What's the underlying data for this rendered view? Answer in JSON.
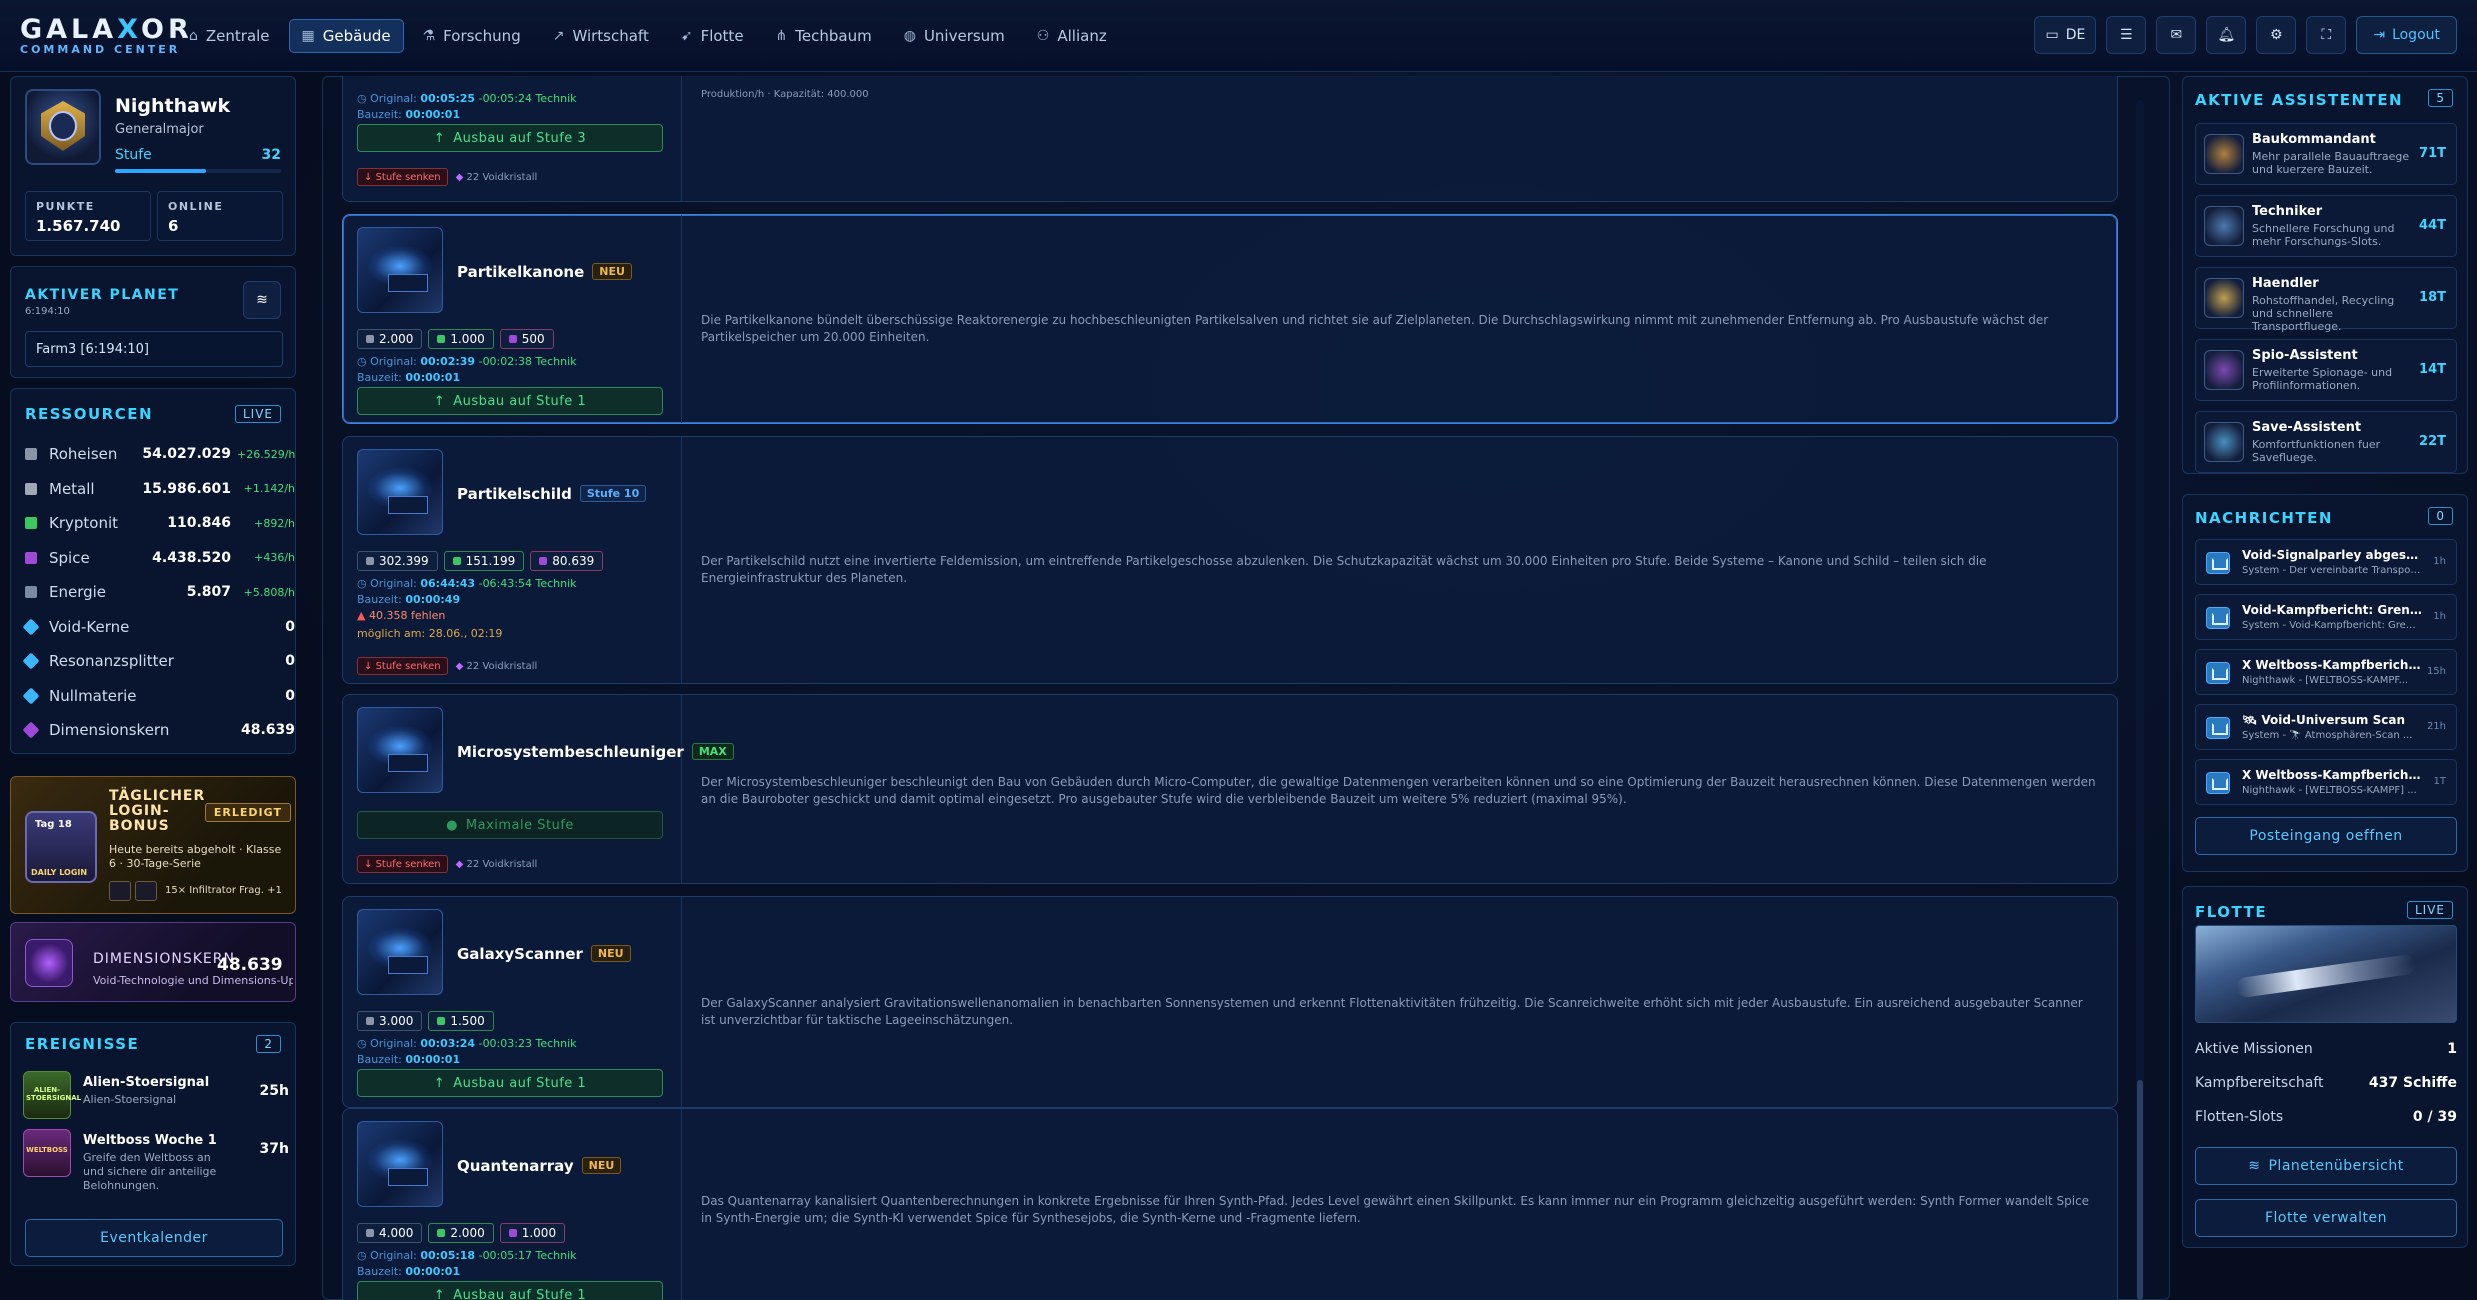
{
  "app": {
    "logo_main": "GALAXOR",
    "logo_sub": "COMMAND CENTER"
  },
  "nav": {
    "items": [
      {
        "label": "Zentrale",
        "icon": "home-icon"
      },
      {
        "label": "Gebäude",
        "icon": "building-icon",
        "active": true
      },
      {
        "label": "Forschung",
        "icon": "flask-icon"
      },
      {
        "label": "Wirtschaft",
        "icon": "chart-icon"
      },
      {
        "label": "Flotte",
        "icon": "rocket-icon"
      },
      {
        "label": "Techbaum",
        "icon": "tree-icon"
      },
      {
        "label": "Universum",
        "icon": "globe-icon"
      },
      {
        "label": "Allianz",
        "icon": "users-icon"
      }
    ],
    "lang": "DE",
    "logout": "Logout"
  },
  "profile": {
    "name": "Nighthawk",
    "rank": "Generalmajor",
    "level_label": "Stufe",
    "level": "32",
    "level_progress": 0.55,
    "points_label": "PUNKTE",
    "points": "1.567.740",
    "online_label": "ONLINE",
    "online": "6"
  },
  "planet": {
    "title": "AKTIVER PLANET",
    "coords": "6:194:10",
    "selected": "Farm3 [6:194:10]"
  },
  "resources": {
    "title": "RESSOURCEN",
    "badge": "LIVE",
    "items": [
      {
        "name": "Roheisen",
        "value": "54.027.029",
        "rate": "+26.529/h",
        "color": "#8a96a8"
      },
      {
        "name": "Metall",
        "value": "15.986.601",
        "rate": "+1.142/h",
        "color": "#a0a8b8"
      },
      {
        "name": "Kryptonit",
        "value": "110.846",
        "rate": "+892/h",
        "color": "#3ac860"
      },
      {
        "name": "Spice",
        "value": "4.438.520",
        "rate": "+436/h",
        "color": "#a048d8"
      },
      {
        "name": "Energie",
        "value": "5.807",
        "rate": "+5.808/h",
        "color": "#7a8aa0"
      },
      {
        "name": "Void-Kerne",
        "value": "0",
        "rate": "",
        "color": "#3ab8ff"
      },
      {
        "name": "Resonanzsplitter",
        "value": "0",
        "rate": "",
        "color": "#3ab8ff"
      },
      {
        "name": "Nullmaterie",
        "value": "0",
        "rate": "",
        "color": "#3ab8ff"
      },
      {
        "name": "Dimensionskern",
        "value": "48.639",
        "rate": "",
        "color": "#a048d8"
      }
    ]
  },
  "login_bonus": {
    "title": "TÄGLICHER LOGIN-BONUS",
    "status": "ERLEDIGT",
    "text": "Heute bereits abgeholt · Klasse 6 · 30-Tage-Serie",
    "reward": "15× Infiltrator Frag. +1",
    "img_label1": "Tag 18",
    "img_label2": "DAILY LOGIN"
  },
  "dimension": {
    "title": "DIMENSIONSKERN",
    "value": "48.639",
    "text": "Void-Technologie und Dimensions-Upgr"
  },
  "events": {
    "title": "EREIGNISSE",
    "count": "2",
    "items": [
      {
        "title": "Alien-Stoersignal",
        "sub": "Alien-Stoersignal",
        "time": "25h",
        "img_label": "ALIEN-STOERSIGNAL"
      },
      {
        "title": "Weltboss Woche 1",
        "sub": "Greife den Weltboss an und sichere dir anteilige Belohnungen.",
        "time": "37h",
        "img_label": "WELTBOSS"
      }
    ],
    "button": "Eventkalender"
  },
  "buildings": {
    "top_partial": {
      "orig_label": "Original:",
      "orig_time": "00:05:25",
      "orig_reduction": "-00:05:24 Technik",
      "build_label": "Bauzeit:",
      "build_time": "00:00:01",
      "button": "Ausbau auf Stufe 3",
      "down": "Stufe senken",
      "void": "22 Voidkristall",
      "production": "Produktion/h · Kapazität: 400.000"
    },
    "cards": [
      {
        "name": "Partikelkanone",
        "tag": "NEU",
        "tag_type": "neu",
        "costs": [
          "2.000",
          "1.000",
          "500"
        ],
        "orig_time": "00:02:39",
        "orig_reduction": "-00:02:38 Technik",
        "build_time": "00:00:01",
        "button": "Ausbau auf Stufe 1",
        "desc": "Die Partikelkanone bündelt überschüssige Reaktorenergie zu hochbeschleunigten Partikelsalven und richtet sie auf Zielplaneten. Die Durchschlagswirkung nimmt mit zunehmender Entfernung ab. Pro Ausbaustufe wächst der Partikelspeicher um 20.000 Einheiten."
      },
      {
        "name": "Partikelschild",
        "tag": "Stufe 10",
        "tag_type": "lvl",
        "costs": [
          "302.399",
          "151.199",
          "80.639"
        ],
        "orig_time": "06:44:43",
        "orig_reduction": "-06:43:54 Technik",
        "build_time": "00:00:49",
        "missing": "40.358 fehlen",
        "possible": "möglich am: 28.06., 02:19",
        "down": "Stufe senken",
        "void": "22 Voidkristall",
        "desc": "Der Partikelschild nutzt eine invertierte Feldemission, um eintreffende Partikelgeschosse abzulenken. Die Schutzkapazität wächst um 30.000 Einheiten pro Stufe. Beide Systeme – Kanone und Schild – teilen sich die Energieinfrastruktur des Planeten."
      },
      {
        "name": "Microsystembeschleuniger",
        "tag": "MAX",
        "tag_type": "max",
        "button": "Maximale Stufe",
        "down": "Stufe senken",
        "void": "22 Voidkristall",
        "desc": "Der Microsystembeschleuniger beschleunigt den Bau von Gebäuden durch Micro-Computer, die gewaltige Datenmengen verarbeiten können und so eine Optimierung der Bauzeit herausrechnen können. Diese Datenmengen werden an die Bauroboter geschickt und damit optimal eingesetzt. Pro ausgebauter Stufe wird die verbleibende Bauzeit um weitere 5% reduziert (maximal 95%)."
      },
      {
        "name": "GalaxyScanner",
        "tag": "NEU",
        "tag_type": "neu",
        "costs": [
          "3.000",
          "1.500"
        ],
        "orig_time": "00:03:24",
        "orig_reduction": "-00:03:23 Technik",
        "build_time": "00:00:01",
        "button": "Ausbau auf Stufe 1",
        "desc": "Der GalaxyScanner analysiert Gravitationswellenanomalien in benachbarten Sonnensystemen und erkennt Flottenaktivitäten frühzeitig. Die Scanreichweite erhöht sich mit jeder Ausbaustufe. Ein ausreichend ausgebauter Scanner ist unverzichtbar für taktische Lageeinschätzungen."
      },
      {
        "name": "Quantenarray",
        "tag": "NEU",
        "tag_type": "neu",
        "costs": [
          "4.000",
          "2.000",
          "1.000"
        ],
        "orig_time": "00:05:18",
        "orig_reduction": "-00:05:17 Technik",
        "build_time": "00:00:01",
        "button": "Ausbau auf Stufe 1",
        "desc": "Das Quantenarray kanalisiert Quantenberechnungen in konkrete Ergebnisse für Ihren Synth-Pfad. Jedes Level gewährt einen Skillpunkt. Es kann immer nur ein Programm gleichzeitig ausgeführt werden: Synth Former wandelt Spice in Synth-Energie um; die Synth-KI verwendet Spice für Synthesejobs, die Synth-Kerne und -Fragmente liefern."
      }
    ],
    "labels": {
      "orig": "Original:",
      "bauzeit": "Bauzeit:"
    }
  },
  "assistants": {
    "title": "AKTIVE ASSISTENTEN",
    "count": "5",
    "items": [
      {
        "name": "Baukommandant",
        "desc": "Mehr parallele Bauauftraege und kuerzere Bauzeit.",
        "time": "71T"
      },
      {
        "name": "Techniker",
        "desc": "Schnellere Forschung und mehr Forschungs-Slots.",
        "time": "44T"
      },
      {
        "name": "Haendler",
        "desc": "Rohstoffhandel, Recycling und schnellere Transportfluege.",
        "time": "18T"
      },
      {
        "name": "Spio-Assistent",
        "desc": "Erweiterte Spionage- und Profilinformationen.",
        "time": "14T"
      },
      {
        "name": "Save-Assistent",
        "desc": "Komfortfunktionen fuer Savefluege.",
        "time": "22T"
      }
    ]
  },
  "messages": {
    "title": "NACHRICHTEN",
    "count": "0",
    "items": [
      {
        "title": "Void-Signalparley abgeschlo...",
        "sub": "System - Der vereinbarte Transport...",
        "time": "1h"
      },
      {
        "title": "Void-Kampfbericht: Grenzpat...",
        "sub": "System - Void-Kampfbericht: Grenz...",
        "time": "1h"
      },
      {
        "title": "X Weltboss-Kampfbericht ...",
        "sub": "Nighthawk - [WELTBOSS-KAMPF...",
        "time": "15h"
      },
      {
        "title": "🛰 Void-Universum Scan",
        "sub": "System - 🔭 Atmosphären-Scan ...",
        "time": "21h"
      },
      {
        "title": "X Weltboss-Kampfbericht — ...",
        "sub": "Nighthawk - [WELTBOSS-KAMPF] ...",
        "time": "1T"
      }
    ],
    "button": "Posteingang oeffnen"
  },
  "fleet": {
    "title": "FLOTTE",
    "badge": "LIVE",
    "rows": [
      {
        "label": "Aktive Missionen",
        "value": "1"
      },
      {
        "label": "Kampfbereitschaft",
        "value": "437 Schiffe"
      },
      {
        "label": "Flotten-Slots",
        "value": "0 / 39"
      }
    ],
    "btn1": "Planetenübersicht",
    "btn2": "Flotte verwalten"
  }
}
